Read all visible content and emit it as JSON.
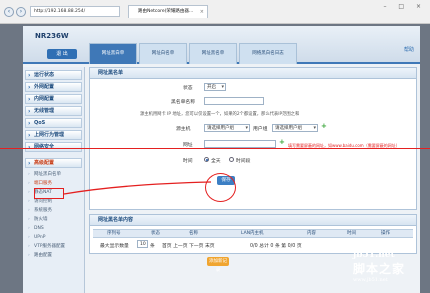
{
  "browser": {
    "back": "‹",
    "forward": "›",
    "address": "http://192.168.88.254/",
    "tab_title": "路由Netcore)荣耀路由器...",
    "tab_close": "×",
    "window_buttons": "– □ ×"
  },
  "router": {
    "model": "NR236W",
    "logout_label": "退 出",
    "top_tabs": [
      "网址黑白单",
      "网址白名单",
      "网址黑名单",
      "网络黑白名日志"
    ],
    "help_label": "帮助"
  },
  "sidebar": {
    "items": [
      "运行状态",
      "外网配置",
      "内网配置",
      "无线管理",
      "QoS",
      "上网行为管理",
      "网络安全",
      "高级配置"
    ],
    "subitems": [
      "网址黑白名单",
      "端口服务",
      "静态NAT",
      "访问控制",
      "系统服务",
      "防火墙",
      "DNS",
      "UPnP",
      "VTP服务器配置",
      "路由配置"
    ]
  },
  "form": {
    "section_title": "网址黑名单",
    "status_label": "状态",
    "status_value": "开启",
    "name_label": "黑名单名称",
    "hint": "源主机用网卡 IP 地址，您可以仅设置一个，如果的2个都设置，那么代表IP范围之和",
    "host_label": "源主机",
    "host_select": "请选择用户组",
    "user_group_label": "用户组",
    "user_group_select": "请选择用户组",
    "url_label": "网址",
    "time_label": "时间",
    "time_all": "全天",
    "time_period": "时间段",
    "save_label": "保存"
  },
  "table": {
    "section_title": "网址黑名单内容",
    "headers": [
      "序列号",
      "状态",
      "名称",
      "LAN内主机",
      "内容",
      "时间",
      "操作"
    ],
    "pager_label": "最大显示数量",
    "pager_value": "10",
    "pager_unit": "条",
    "pager_nav": "首页  上一页  下一页  末页",
    "pager_info": "0/0   总计 0 条   第 0/0 页",
    "add_label": "添加新记录"
  },
  "annotation": {
    "note": "填写需要屏蔽的网址，如www.baidu.com（需要屏蔽的网址）"
  },
  "watermark": {
    "site": "jb51.net",
    "brand": "脚本之家",
    "url": "www.jb51.net"
  }
}
